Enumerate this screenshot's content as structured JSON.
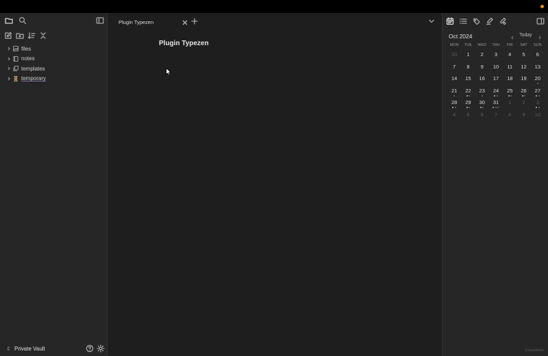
{
  "colors": {
    "accent": "#e0901c",
    "background": "#1e1e1e",
    "sidebar": "#262626"
  },
  "left_pane": {
    "header_icons": [
      "folder-icon",
      "search-icon",
      "sidebar-toggle-icon"
    ],
    "action_icons": [
      "new-note-icon",
      "new-folder-icon",
      "sort-icon",
      "collapse-all-icon"
    ],
    "tree": [
      {
        "label": "files",
        "icon": "image-icon",
        "underline": false
      },
      {
        "label": "notes",
        "icon": "book-icon",
        "underline": false
      },
      {
        "label": "templates",
        "icon": "copy-icon",
        "underline": false
      },
      {
        "label": "temporary",
        "icon": "hourglass-icon",
        "underline": true
      }
    ],
    "vault_name": "Private Vault"
  },
  "tabs": [
    {
      "label": "Plugin Typezen",
      "active": true
    }
  ],
  "editor": {
    "title": "Plugin Typezen"
  },
  "right_pane": {
    "header_icons": [
      "calendar-icon",
      "list-icon",
      "tags-icon",
      "edit-link-icon",
      "edit-search-icon"
    ],
    "calendar": {
      "month_label": "Oct 2024",
      "today_label": "Today",
      "weekdays": [
        "MON",
        "TUE",
        "WED",
        "THU",
        "FRI",
        "SAT",
        "SUN"
      ],
      "weeks": [
        [
          {
            "d": "30",
            "m": true,
            "dots": 0
          },
          {
            "d": "1",
            "m": false,
            "dots": 0
          },
          {
            "d": "2",
            "m": false,
            "dots": 0
          },
          {
            "d": "3",
            "m": false,
            "dots": 0
          },
          {
            "d": "4",
            "m": false,
            "dots": 0
          },
          {
            "d": "5",
            "m": false,
            "dots": 0
          },
          {
            "d": "6",
            "m": false,
            "dots": 0
          }
        ],
        [
          {
            "d": "7",
            "m": false,
            "dots": 0
          },
          {
            "d": "8",
            "m": false,
            "dots": 0
          },
          {
            "d": "9",
            "m": false,
            "dots": 0
          },
          {
            "d": "10",
            "m": false,
            "dots": 0
          },
          {
            "d": "11",
            "m": false,
            "dots": 0
          },
          {
            "d": "12",
            "m": false,
            "dots": 0
          },
          {
            "d": "13",
            "m": false,
            "dots": 0
          }
        ],
        [
          {
            "d": "14",
            "m": false,
            "dots": 0
          },
          {
            "d": "15",
            "m": false,
            "dots": 0
          },
          {
            "d": "16",
            "m": false,
            "dots": 0
          },
          {
            "d": "17",
            "m": false,
            "dots": 0
          },
          {
            "d": "18",
            "m": false,
            "dots": 0
          },
          {
            "d": "19",
            "m": false,
            "dots": 0
          },
          {
            "d": "20",
            "m": false,
            "dots": 1
          }
        ],
        [
          {
            "d": "21",
            "m": false,
            "dots": 1
          },
          {
            "d": "22",
            "m": false,
            "dots": 2
          },
          {
            "d": "23",
            "m": false,
            "dots": 1
          },
          {
            "d": "24",
            "m": false,
            "dots": 2
          },
          {
            "d": "25",
            "m": false,
            "dots": 2
          },
          {
            "d": "26",
            "m": false,
            "dots": 2
          },
          {
            "d": "27",
            "m": false,
            "dots": 2
          }
        ],
        [
          {
            "d": "28",
            "m": false,
            "dots": 2
          },
          {
            "d": "29",
            "m": false,
            "dots": 2
          },
          {
            "d": "30",
            "m": false,
            "dots": 2
          },
          {
            "d": "31",
            "m": false,
            "dots": 3
          },
          {
            "d": "1",
            "m": true,
            "dots": 0
          },
          {
            "d": "2",
            "m": true,
            "dots": 0
          },
          {
            "d": "3",
            "m": true,
            "dots": 2
          }
        ],
        [
          {
            "d": "4",
            "m": true,
            "dots": 0
          },
          {
            "d": "5",
            "m": true,
            "dots": 0
          },
          {
            "d": "6",
            "m": true,
            "dots": 0
          },
          {
            "d": "7",
            "m": true,
            "dots": 0
          },
          {
            "d": "8",
            "m": true,
            "dots": 0
          },
          {
            "d": "9",
            "m": true,
            "dots": 0
          },
          {
            "d": "10",
            "m": true,
            "dots": 0
          }
        ]
      ]
    },
    "backlinks_label": "0 backlinks"
  }
}
